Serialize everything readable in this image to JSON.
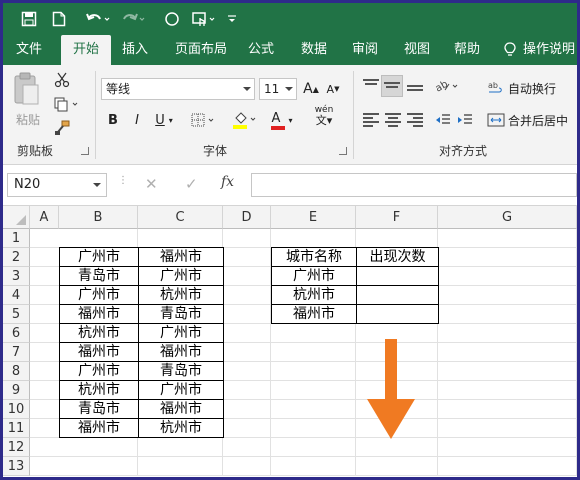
{
  "qat": {
    "icons": [
      "save-icon",
      "new-file-icon",
      "undo-icon",
      "redo-icon",
      "shape-icon",
      "touch-icon",
      "customize-icon"
    ]
  },
  "tabs": {
    "items": [
      "文件",
      "开始",
      "插入",
      "页面布局",
      "公式",
      "数据",
      "审阅",
      "视图",
      "帮助",
      "操作说明"
    ],
    "active": "开始"
  },
  "ribbon": {
    "clipboard": {
      "paste_label": "粘贴",
      "group_label": "剪贴板"
    },
    "font": {
      "font_name": "等线",
      "font_size": "11",
      "grow_label": "A",
      "shrink_label": "A",
      "bold": "B",
      "italic": "I",
      "underline": "U",
      "font_color_label": "A",
      "phonetic_label": "wén",
      "group_label": "字体"
    },
    "alignment": {
      "wrap_text": "自动换行",
      "merge_center": "合并后居中",
      "group_label": "对齐方式"
    }
  },
  "formula_bar": {
    "name_box": "N20",
    "cancel": "✕",
    "enter": "✓",
    "fx": "fx",
    "value": ""
  },
  "sheet": {
    "columns": [
      "A",
      "B",
      "C",
      "D",
      "E",
      "F",
      "G"
    ],
    "rows": [
      "1",
      "2",
      "3",
      "4",
      "5",
      "6",
      "7",
      "8",
      "9",
      "10",
      "11",
      "12",
      "13"
    ],
    "col_b": [
      "广州市",
      "青岛市",
      "广州市",
      "福州市",
      "杭州市",
      "福州市",
      "广州市",
      "杭州市",
      "青岛市",
      "福州市"
    ],
    "col_c": [
      "福州市",
      "广州市",
      "杭州市",
      "青岛市",
      "广州市",
      "福州市",
      "青岛市",
      "广州市",
      "福州市",
      "杭州市"
    ],
    "e_header": "城市名称",
    "f_header": "出现次数",
    "e_values": [
      "广州市",
      "杭州市",
      "福州市"
    ],
    "arrow_color": "#f07a22"
  }
}
